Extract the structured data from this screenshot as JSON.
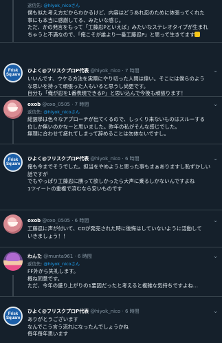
{
  "tweets": [
    {
      "reply_prefix": "返信先: ",
      "reply_to": "@hiyok_nicoさん",
      "lines": [
        "僕も似た考え方だからわかるけど、内容はどうあれ忍のために体張ってくれた",
        "事にも本当に感謝してる、みたいな感じ。",
        "ただ、かの発言をもって「工藤忍Pといえば」みたいなステレオタイプが生まれ",
        "ちゃうと不満なので、「俺こそが誰より一番工藤忍P」と思って生きてます"
      ]
    },
    {
      "name": "ひよく@フリスクプロP代表",
      "handle": "@hiyok_nico",
      "time": "7 時間",
      "lines": [
        "いいんです、ウケる方法を実際にやり切った人間は偉い。そこには僕らのよう",
        "な思いを持って頑張った人もいると思うし尚更です。",
        "自分も「俺が忍を1番表現できるP」と思い込んで今後も頑張ります！"
      ]
    },
    {
      "name": "oxob",
      "handle": "@oxo_0505",
      "time": "7 時間",
      "reply_prefix": "返信先: ",
      "reply_to": "@hiyok_nicoさん",
      "lines": [
        "総選挙は色々なアプローチが出てくるので、しっくり来ないものはスルーする",
        "位しか無いのかなーと思いました。昨年の私がそんな感じでした。",
        "無理に合わせて疲れてしまって辞めることは勿体ないですし。"
      ]
    },
    {
      "name": "ひよく@フリスクプロP代表",
      "handle": "@hiyok_nico",
      "time": "6 時間",
      "lines": [
        "俺も今までそうでした。担当をやめようと思った事もまぁありますし恥ずかしい",
        "話ですが",
        "でもやっぱり工藤忍に勝って欲しかったら大声に乗るしかないんですよね",
        "1ツイートの重複で済むなら安いものです"
      ]
    },
    {
      "name": "oxob",
      "handle": "@oxo_0505",
      "time": "6 時間",
      "lines": [
        "工藤忍に声が付いて、CDが発売された時に後悔はしていないように活動して",
        "いきましょう！！"
      ]
    },
    {
      "name": "わんた",
      "handle": "@munta961",
      "time": "6 時間",
      "reply_prefix": "返信先: ",
      "reply_to": "@hiyok_nicoさん",
      "lines": [
        "FF外から失礼します。",
        "概ね同意です。",
        "ただ、今年の盛り上がりの1要因だったと考えると複雑な気持ちですよね…"
      ]
    },
    {
      "name": "ひよく@フリスクプロP代表",
      "handle": "@hiyok_nico",
      "time": "6 時間",
      "lines": [
        "ありがとうございます",
        "なんでこう言う流れになったんでしょうかね",
        "毎年毎年思います"
      ]
    }
  ],
  "avatar_text": "Frisk Square",
  "colors": {
    "background": "#15202b",
    "border": "#38444d",
    "text": "#e1e8ed",
    "muted": "#8899a6",
    "link": "#1da1f2"
  }
}
